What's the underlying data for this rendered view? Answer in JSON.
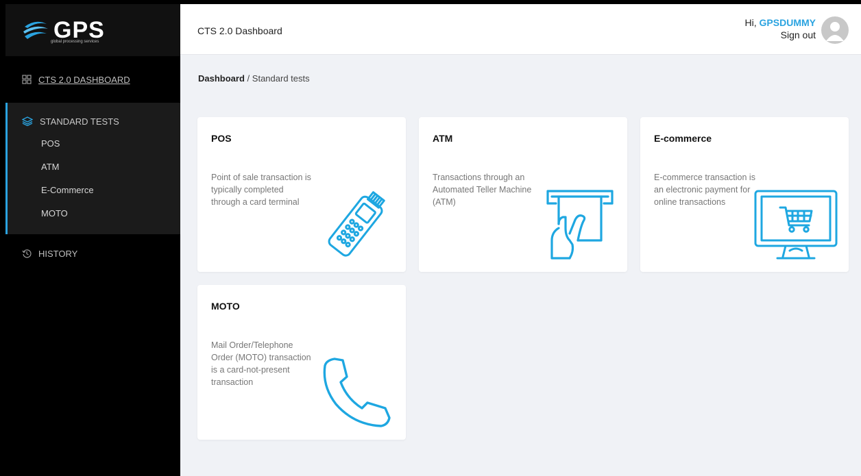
{
  "brand": {
    "name": "GPS",
    "tagline": "global processing services"
  },
  "sidebar": {
    "dashboard_label": "CTS 2.0 DASHBOARD",
    "group_label": "STANDARD TESTS",
    "items": [
      {
        "label": "POS"
      },
      {
        "label": "ATM"
      },
      {
        "label": "E-Commerce"
      },
      {
        "label": "MOTO"
      }
    ],
    "history_label": "HISTORY"
  },
  "header": {
    "title": "CTS 2.0 Dashboard",
    "greeting": "Hi,",
    "username": "GPSDUMMY",
    "signout": "Sign out"
  },
  "breadcrumb": {
    "root": "Dashboard",
    "sep": "/",
    "current": "Standard tests"
  },
  "cards": [
    {
      "title": "POS",
      "desc": "Point of sale transaction is typically completed through a card terminal",
      "icon": "card-terminal-icon"
    },
    {
      "title": "ATM",
      "desc": "Transactions through an Automated Teller Machine (ATM)",
      "icon": "atm-icon"
    },
    {
      "title": "E-commerce",
      "desc": "E-commerce transaction is an electronic payment for online transactions",
      "icon": "monitor-cart-icon"
    },
    {
      "title": "MOTO",
      "desc": "Mail Order/Telephone Order (MOTO) transaction is a card-not-present transaction",
      "icon": "phone-icon"
    }
  ],
  "colors": {
    "accent": "#2aa3e0",
    "sidebar": "#000000",
    "background": "#f0f2f6"
  }
}
